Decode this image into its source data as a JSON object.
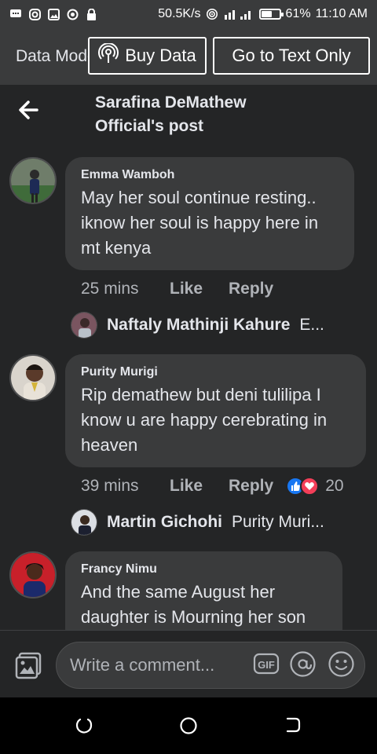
{
  "status_bar": {
    "speed": "50.5K/s",
    "battery": "61%",
    "battery_level": 0.61,
    "time": "11:10 AM"
  },
  "data_bar": {
    "mode_label": "Data Mode",
    "buy_data": "Buy Data",
    "text_only": "Go to Text Only"
  },
  "header": {
    "title_line1": "Sarafina DeMathew",
    "title_line2": "Official's post"
  },
  "comments": [
    {
      "name": "Emma Wamboh",
      "lines": [
        "May her soul continue resting..",
        "iknow her soul is happy here in",
        "mt kenya"
      ],
      "time": "25 mins",
      "like": "Like",
      "reply": "Reply",
      "reply_preview": {
        "name": "Naftaly Mathinji Kahure",
        "text": "E..."
      }
    },
    {
      "name": "Purity Murigi",
      "lines": [
        "Rip demathew but  deni tulilipa I",
        "know u are happy cerebrating in",
        "heaven"
      ],
      "time": "39 mins",
      "like": "Like",
      "reply": "Reply",
      "reaction_count": "20",
      "reply_preview": {
        "name": "Martin Gichohi",
        "text": "Purity Muri..."
      }
    },
    {
      "name": "Francy Nimu",
      "lines": [
        "And the same August her",
        "daughter is Mourning her son"
      ]
    }
  ],
  "composer": {
    "placeholder": "Write a comment..."
  },
  "icons": {
    "accent": "#1877f2",
    "love": "#f33e58"
  }
}
